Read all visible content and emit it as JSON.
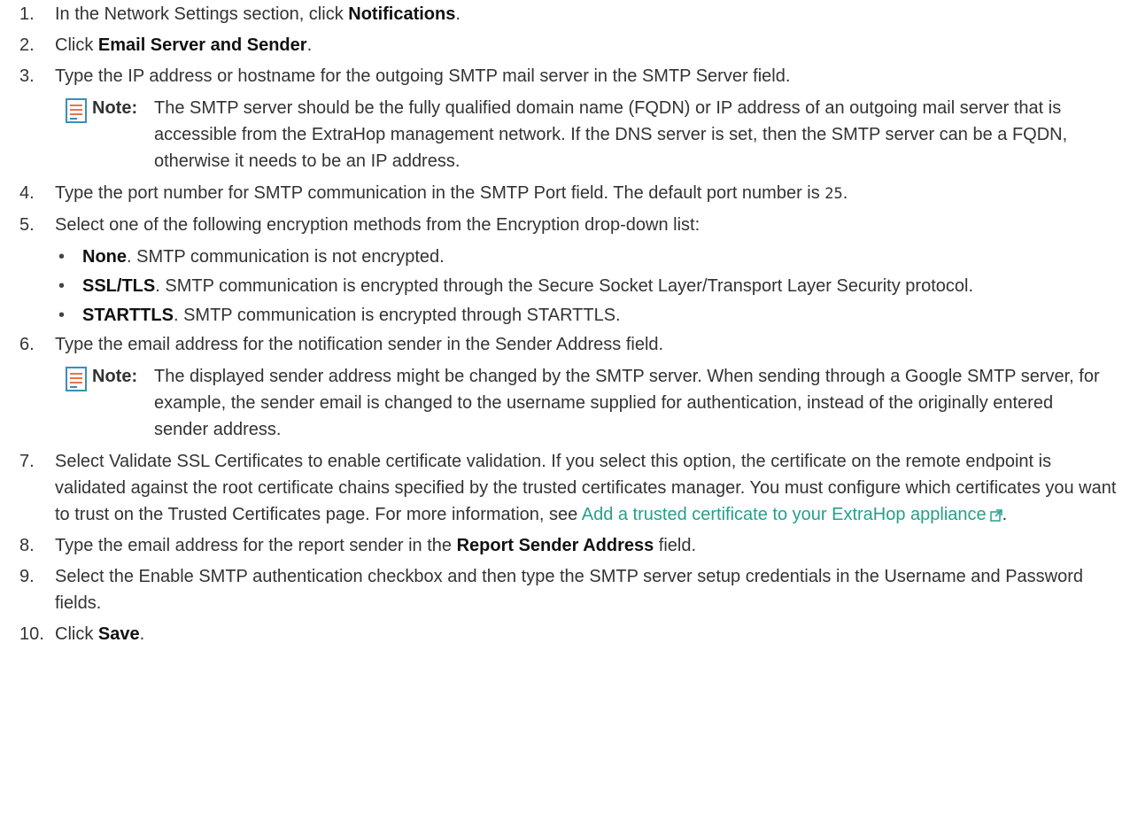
{
  "steps": {
    "s1": {
      "num": "1.",
      "pre": "In the Network Settings section, click ",
      "bold": "Notifications",
      "post": "."
    },
    "s2": {
      "num": "2.",
      "pre": "Click ",
      "bold": "Email Server and Sender",
      "post": "."
    },
    "s3": {
      "num": "3.",
      "text": "Type the IP address or hostname for the outgoing SMTP mail server in the SMTP Server field.",
      "note_label": "Note:",
      "note_text": "The SMTP server should be the fully qualified domain name (FQDN) or IP address of an outgoing mail server that is accessible from the ExtraHop management network. If the DNS server is set, then the SMTP server can be a FQDN, otherwise it needs to be an IP address."
    },
    "s4": {
      "num": "4.",
      "text": "Type the port number for SMTP communication in the SMTP Port field. The default port number is ",
      "code": "25",
      "post": "."
    },
    "s5": {
      "num": "5.",
      "text": "Select one of the following encryption methods from the Encryption drop-down list:",
      "bullets": [
        {
          "bold": "None",
          "text": ". SMTP communication is not encrypted."
        },
        {
          "bold": "SSL/TLS",
          "text": ". SMTP communication is encrypted through the Secure Socket Layer/Transport Layer Security protocol."
        },
        {
          "bold": "STARTTLS",
          "text": ". SMTP communication is encrypted through STARTTLS."
        }
      ]
    },
    "s6": {
      "num": "6.",
      "text": "Type the email address for the notification sender in the Sender Address field.",
      "note_label": "Note:",
      "note_text": "The displayed sender address might be changed by the SMTP server. When sending through a Google SMTP server, for example, the sender email is changed to the username supplied for authentication, instead of the originally entered sender address."
    },
    "s7": {
      "num": "7.",
      "text": "Select Validate SSL Certificates to enable certificate validation. If you select this option, the certificate on the remote endpoint is validated against the root certificate chains specified by the trusted certificates manager. You must configure which certificates you want to trust on the Trusted Certificates page. For more information, see ",
      "link": "Add a trusted certificate to your ExtraHop appliance",
      "post": "."
    },
    "s8": {
      "num": "8.",
      "pre": "Type the email address for the report sender in the ",
      "bold": "Report Sender Address",
      "post": " field."
    },
    "s9": {
      "num": "9.",
      "text": "Select the Enable SMTP authentication checkbox and then type the SMTP server setup credentials in the Username and Password fields."
    },
    "s10": {
      "num": "10.",
      "pre": "Click ",
      "bold": "Save",
      "post": "."
    }
  },
  "icons": {
    "note": "note-document-icon",
    "external": "external-link-icon"
  },
  "colors": {
    "text": "#333333",
    "link": "#24a08a",
    "note_icon_lines": "#e8734a",
    "note_icon_frame": "#3a8fb7"
  }
}
